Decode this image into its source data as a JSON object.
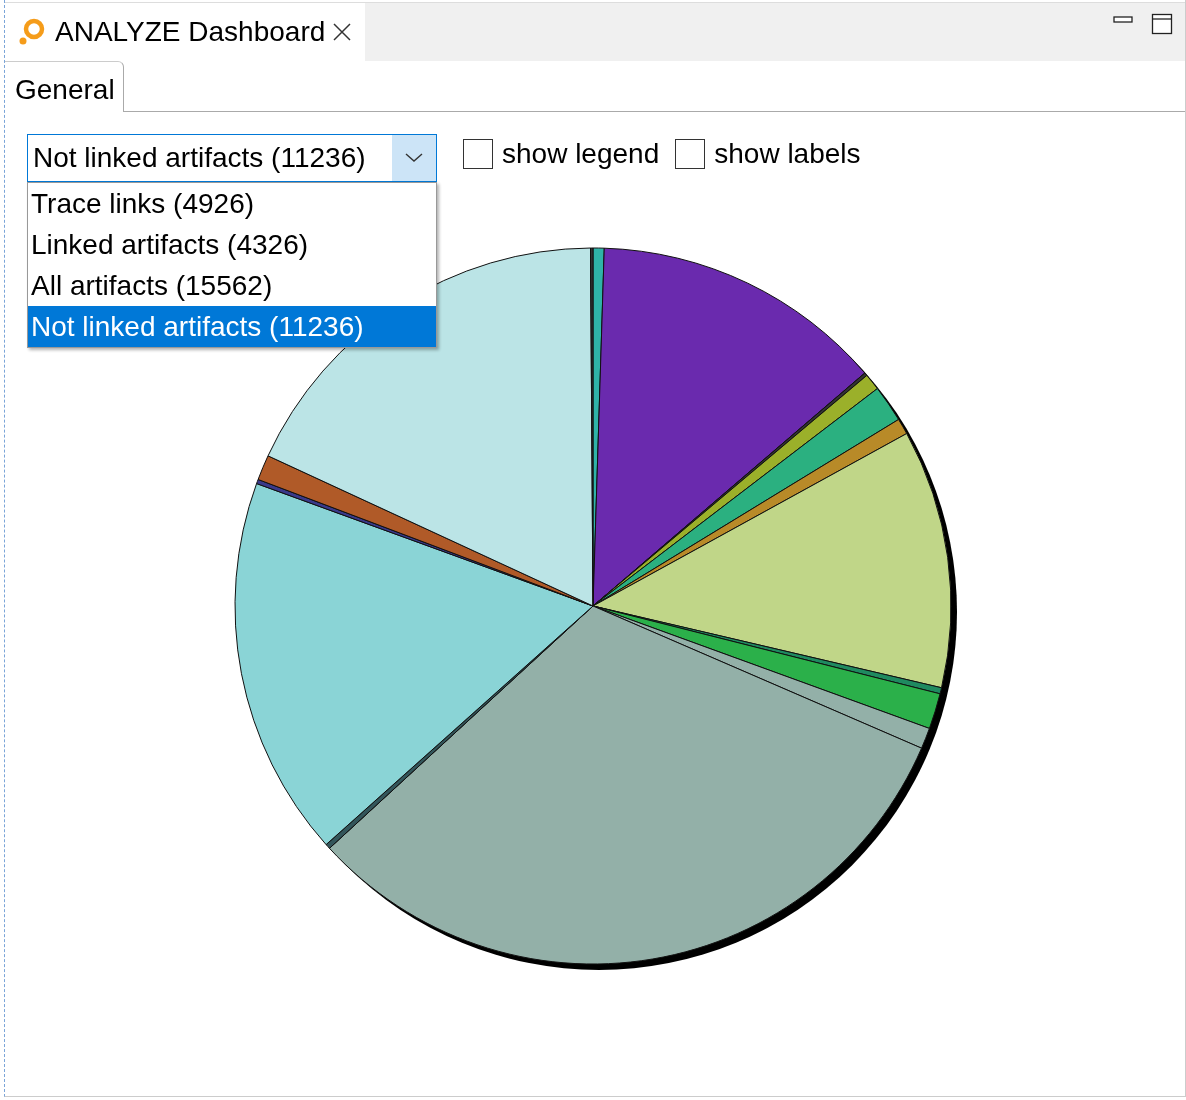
{
  "editor_tabs": [
    {
      "title": "ANALYZE Dashboard",
      "selected": true
    }
  ],
  "subtabs": [
    {
      "label": "General",
      "selected": true
    }
  ],
  "dropdown": {
    "value": "Not linked artifacts (11236)",
    "expanded": true,
    "options": [
      {
        "label": "Trace links (4926)",
        "selected": false
      },
      {
        "label": "Linked artifacts (4326)",
        "selected": false
      },
      {
        "label": "All artifacts (15562)",
        "selected": false
      },
      {
        "label": "Not linked artifacts (11236)",
        "selected": true
      }
    ]
  },
  "checkboxes": [
    {
      "label": "show legend",
      "checked": false
    },
    {
      "label": "show labels",
      "checked": false
    }
  ],
  "chart": {
    "kind": "pie"
  }
}
